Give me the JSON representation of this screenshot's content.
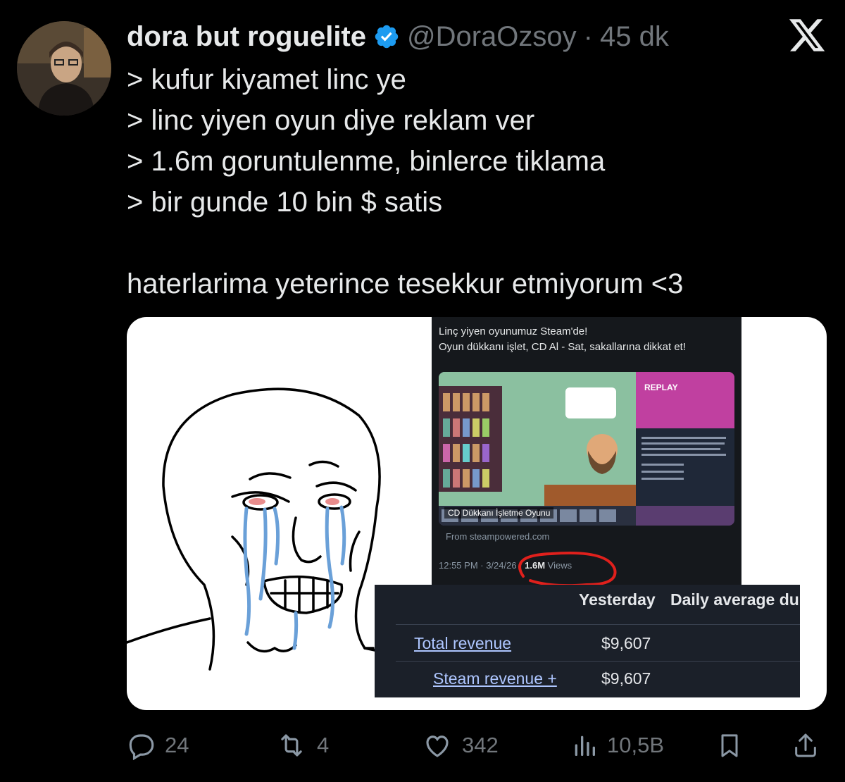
{
  "author": {
    "display_name": "dora but roguelite",
    "handle": "@DoraOzsoy",
    "separator": "·",
    "time": "45 dk"
  },
  "tweet": {
    "lines": [
      "> kufur kiyamet linc ye",
      "> linc yiyen oyun diye reklam ver",
      "> 1.6m goruntulenme, binlerce tiklama",
      "> bir gunde 10 bin $ satis",
      "haterlarima yeterince tesekkur etmiyorum <3"
    ]
  },
  "media": {
    "ad_tweet": {
      "line1": "Linç yiyen oyunumuz Steam'de!",
      "line2": "Oyun dükkanı işlet, CD Al - Sat, sakallarına dikkat et!",
      "card_caption": "CD Dükkanı İşletme Oyunu",
      "from": "From steampowered.com",
      "timestamp": "12:55 PM · 3/24/26 · ",
      "views": "1.6M",
      "views_label": " Views"
    },
    "revenue": {
      "col_yesterday": "Yesterday",
      "col_daily": "Daily average du",
      "row1_label": "Total revenue",
      "row1_value": "$9,607",
      "row2_label": "Steam revenue +",
      "row2_value": "$9,607"
    }
  },
  "actions": {
    "replies": "24",
    "reposts": "4",
    "likes": "342",
    "views": "10,5B"
  },
  "colors": {
    "background": "#000000",
    "text": "#e7e9ea",
    "muted": "#71767b",
    "verified": "#1d9bf0"
  }
}
